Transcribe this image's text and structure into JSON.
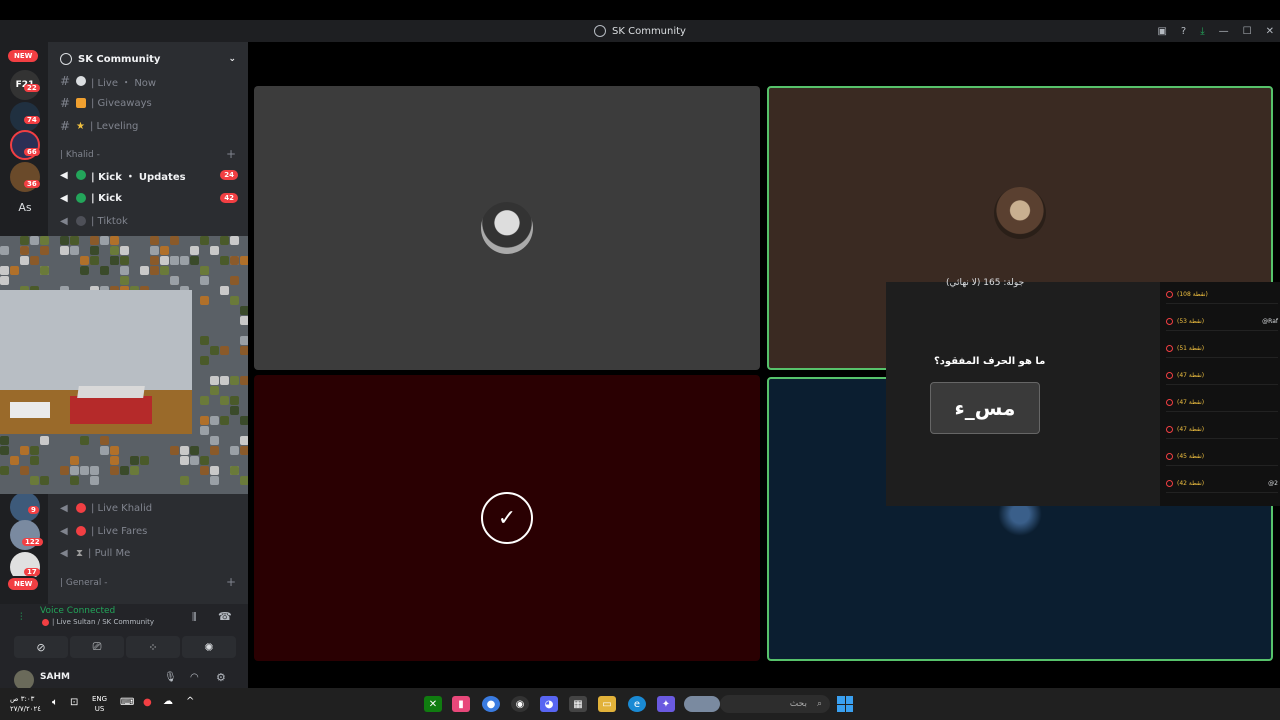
{
  "window": {
    "title": "SK Community",
    "controls": [
      "inbox-icon",
      "help-icon",
      "download-icon",
      "minimize-icon",
      "maximize-icon",
      "close-icon"
    ]
  },
  "guilds": [
    {
      "name": "new-badge",
      "label": "NEW"
    },
    {
      "name": "guild-f21",
      "badge": "22",
      "color": "#3a3a3a"
    },
    {
      "name": "guild-2",
      "badge": "74",
      "color": "#203040"
    },
    {
      "name": "guild-3",
      "badge": "66",
      "color": "#2c2f55"
    },
    {
      "name": "guild-4",
      "badge": "36",
      "color": "#6a4a2a"
    },
    {
      "name": "guild-as",
      "text": "As"
    },
    {
      "name": "guild-5",
      "badge": "9",
      "color": "#3d5a7a"
    },
    {
      "name": "guild-6",
      "badge": "122",
      "color": "#7a8aa0"
    },
    {
      "name": "guild-7",
      "badge": "17",
      "color": "#e0e0e0"
    },
    {
      "name": "new-badge-2",
      "label": "NEW"
    }
  ],
  "server": {
    "name": "SK Community",
    "channels_top": [
      {
        "label": "| Live ・ Now",
        "dot": "#dbdee1"
      },
      {
        "label": "| Giveaways",
        "dot": "#f0a030"
      },
      {
        "label": "| Leveling",
        "dot": "#f0c040"
      }
    ],
    "category1": "| Khalid -",
    "voice1": [
      {
        "label": "| Kick ・ Updates",
        "dot": "#23a55a",
        "count": "24",
        "bold": true
      },
      {
        "label": "| Kick",
        "dot": "#23a55a",
        "count": "42",
        "bold": true
      },
      {
        "label": "| Tiktok",
        "dot": "#4e5058",
        "bold": false
      }
    ],
    "voice2": [
      {
        "label": "| Live Khalid",
        "dot": "#f23f43"
      },
      {
        "label": "| Live Fares",
        "dot": "#f23f43"
      },
      {
        "label": "| Pull Me",
        "dot": "#9a9a9a"
      }
    ],
    "category2": "| General -"
  },
  "voice": {
    "status": "Voice Connected",
    "channel": "| Live Sultan / SK Community"
  },
  "user": {
    "name": "SAHM"
  },
  "overlay": {
    "round": "جولة: 165 (لا نهائي)",
    "question": "ما هو الحرف المفقود؟",
    "word": "مس_ء"
  },
  "leaderboard": [
    {
      "pts": "(108 نقطة)",
      "user": ""
    },
    {
      "pts": "(53 نقطة)",
      "user": "@Raf"
    },
    {
      "pts": "(51 نقطة)",
      "user": ""
    },
    {
      "pts": "(47 نقطة)",
      "user": ""
    },
    {
      "pts": "(47 نقطة)",
      "user": ""
    },
    {
      "pts": "(47 نقطة)",
      "user": ""
    },
    {
      "pts": "(45 نقطة)",
      "user": ""
    },
    {
      "pts": "(42 نقطة)",
      "user": "@2"
    }
  ],
  "taskbar": {
    "search_placeholder": "بحث",
    "lang_top": "ENG",
    "lang_bottom": "US",
    "time": "٣:٠٣ ص",
    "date": "٢٧/٧/٢٠٢٤"
  },
  "colors": {
    "discord_bg": "#2b2d31",
    "speaking_border": "#57c26b",
    "tile_gray": "#3c3c3c",
    "tile_brown": "#3a2a22",
    "tile_red": "#2a0002",
    "tile_blue": "#0b1e30"
  }
}
